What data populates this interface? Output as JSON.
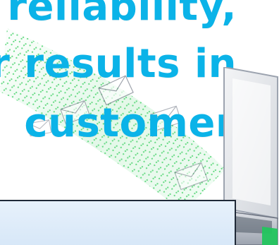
{
  "headline": {
    "line1": "reliability,",
    "line2": "r results in",
    "line3": "customer"
  },
  "colors": {
    "headline": "#0bb3e8",
    "matrix_green": "#49d36c",
    "box_fill": "#dbe9f8",
    "box_border": "#1f2937"
  },
  "icons": [
    "envelope-icon",
    "laptop-icon"
  ]
}
